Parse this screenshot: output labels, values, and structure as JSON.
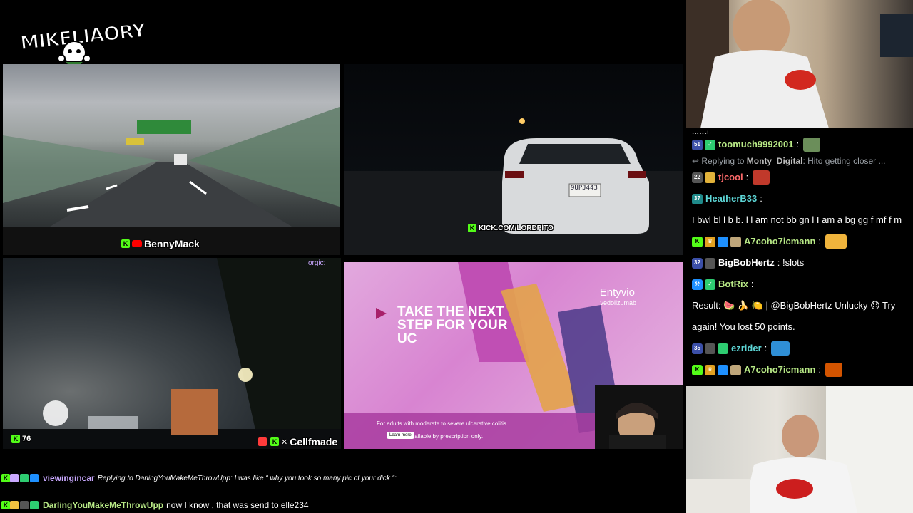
{
  "logo": {
    "text": "MIKELIAORY"
  },
  "tiles": {
    "top_left": {
      "tag": "BennyMack"
    },
    "top_right": {
      "tag": "KICK.COM/LORDPITO",
      "plate": "9UPJ443"
    },
    "bottom_left": {
      "viewer_count": "76",
      "tag": "Cellfmade",
      "corner_user": "orgic:"
    },
    "bottom_right": {
      "headline": "TAKE THE NEXT STEP FOR YOUR UC",
      "brand": "Entyvio",
      "brand_sub": "vedolizumab",
      "footer": "For adults with moderate to severe ulcerative colitis.",
      "footer2": "Available by prescription only.",
      "learn_more": "Learn more"
    }
  },
  "chat": {
    "partial_top": "cool",
    "messages": [
      {
        "user": "toomuch9992001",
        "color": "#b8e986",
        "badge_num": "51",
        "text": ""
      },
      {
        "reply": true,
        "reply_prefix": "Replying to",
        "reply_user": "Monty_Digital",
        "reply_text": "Hito getting closer ..."
      },
      {
        "user": "tjcool",
        "color": "#ff6b6b",
        "badge_num": "22",
        "text": ""
      },
      {
        "user": "HeatherB33",
        "color": "#5dd6d6",
        "badge_num": "37",
        "text": "I bwl bl l b b. l l am not bb gn l I am a bg gg f mf f m"
      },
      {
        "user": "A7coho7icmann",
        "color": "#b8e986",
        "text": ""
      },
      {
        "user": "BigBobHertz",
        "color": "#ffffff",
        "badge_num": "32",
        "text": "!slots"
      },
      {
        "user": "BotRix",
        "color": "#b8e986",
        "text": "Result: 🍉 🍌 🍋 | @BigBobHertz Unlucky 😞 Try again! You lost 50 points."
      },
      {
        "user": "ezrider",
        "color": "#5dd6d6",
        "badge_num": "35",
        "text": ""
      },
      {
        "user": "A7coho7icmann",
        "color": "#b8e986",
        "text": ""
      }
    ]
  },
  "overlay_chat": [
    {
      "user": "viewingincar",
      "user_color": "#c9a8ff",
      "reply": "Replying to DarlingYouMakeMeThrowUpp: I was like “ why you took so many pic of your dick “:"
    },
    {
      "user": "DarlingYouMakeMeThrowUpp",
      "user_color": "#b8e986",
      "text": "now I know , that was send to elle234"
    }
  ],
  "colors": {
    "kick_green": "#53fc18",
    "youtube_red": "#ff0000",
    "ad_pink": "#d884d1"
  }
}
